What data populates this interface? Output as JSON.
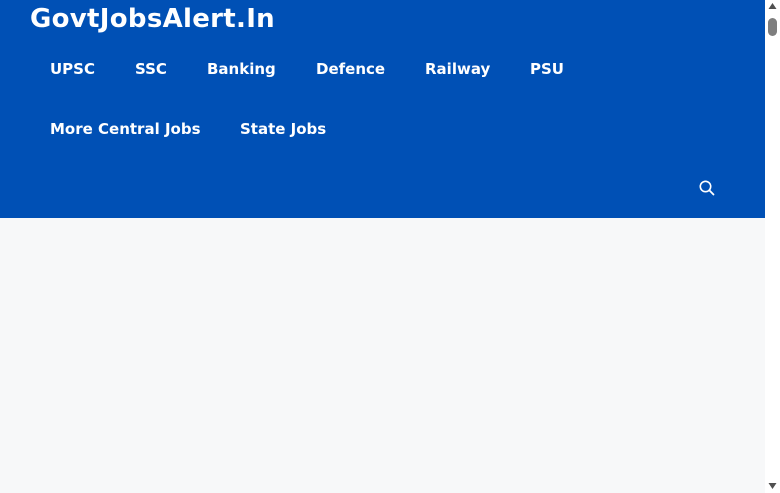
{
  "site": {
    "title": "GovtJobsAlert.In"
  },
  "nav": {
    "items": [
      {
        "label": "UPSC"
      },
      {
        "label": "SSC"
      },
      {
        "label": "Banking"
      },
      {
        "label": "Defence"
      },
      {
        "label": "Railway"
      },
      {
        "label": "PSU"
      },
      {
        "label": "More Central Jobs"
      },
      {
        "label": "State Jobs"
      }
    ]
  },
  "search": {
    "icon": "search-icon"
  },
  "colors": {
    "header_bg": "#0050b5",
    "page_bg": "#f7f8f9",
    "nav_text": "#ffffff"
  }
}
